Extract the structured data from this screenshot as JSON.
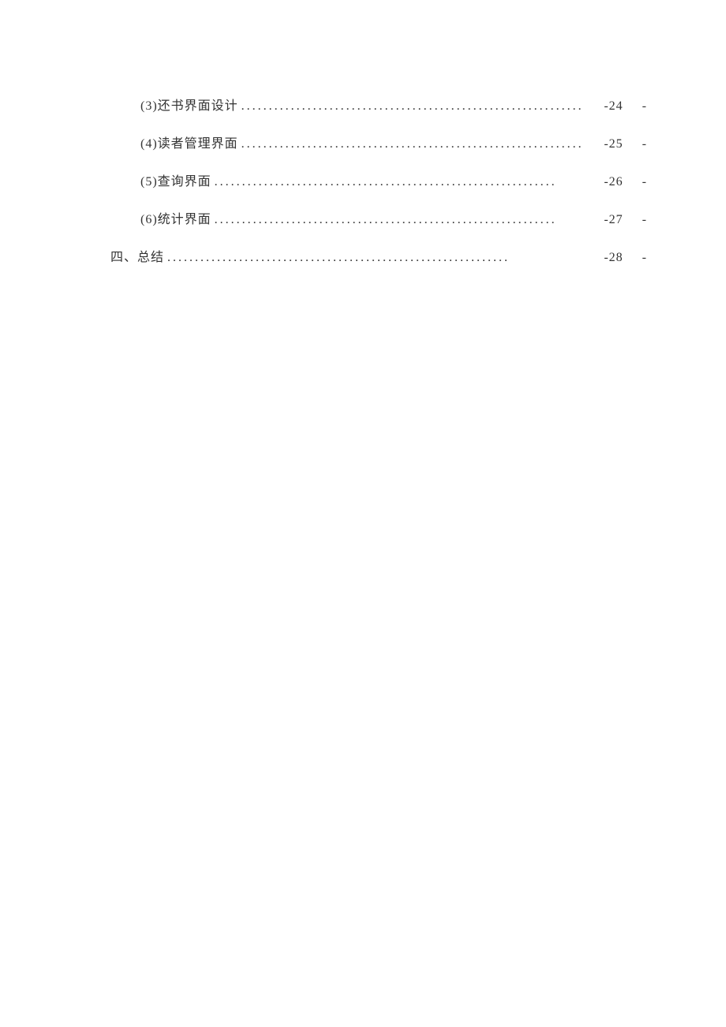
{
  "toc": {
    "dots": "..............................................................",
    "entries": [
      {
        "title": "(3)还书界面设计",
        "page": "-24",
        "dash": "-",
        "indented": true
      },
      {
        "title": "(4)读者管理界面",
        "page": "-25",
        "dash": "-",
        "indented": true
      },
      {
        "title": "(5)查询界面",
        "page": "-26",
        "dash": "-",
        "indented": true
      },
      {
        "title": "(6)统计界面",
        "page": "-27",
        "dash": "-",
        "indented": true
      },
      {
        "title": "四、总结",
        "page": "-28",
        "dash": "-",
        "indented": false
      }
    ]
  }
}
